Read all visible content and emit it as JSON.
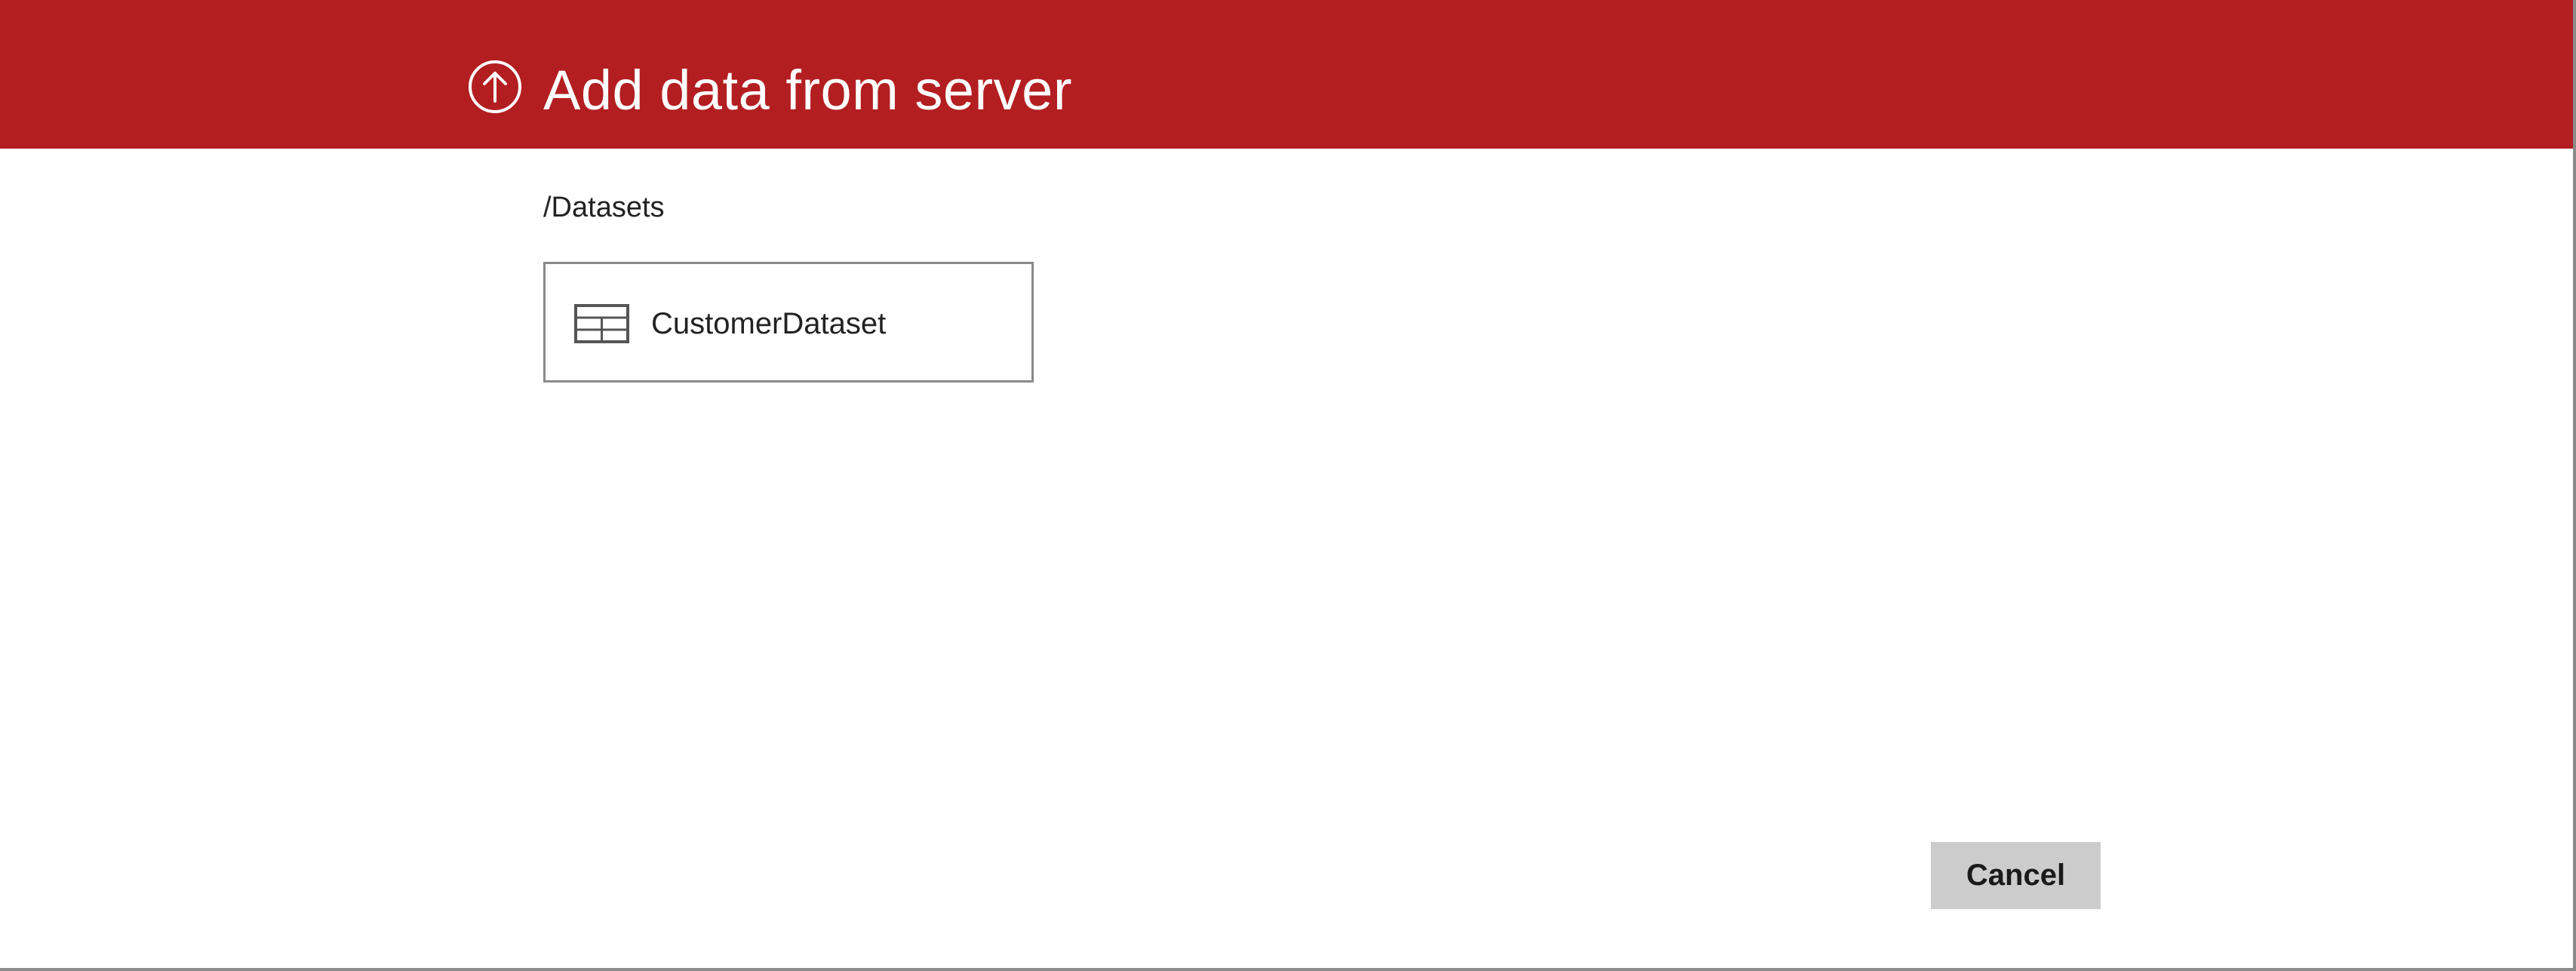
{
  "dialog": {
    "title": "Add data from server",
    "header_icon": "upload-circle-arrow-icon",
    "accent_color": "#b31e21"
  },
  "breadcrumb": {
    "path": "/Datasets"
  },
  "datasets": {
    "items": [
      {
        "label": "CustomerDataset",
        "icon": "table-icon"
      }
    ]
  },
  "footer": {
    "cancel_label": "Cancel"
  }
}
